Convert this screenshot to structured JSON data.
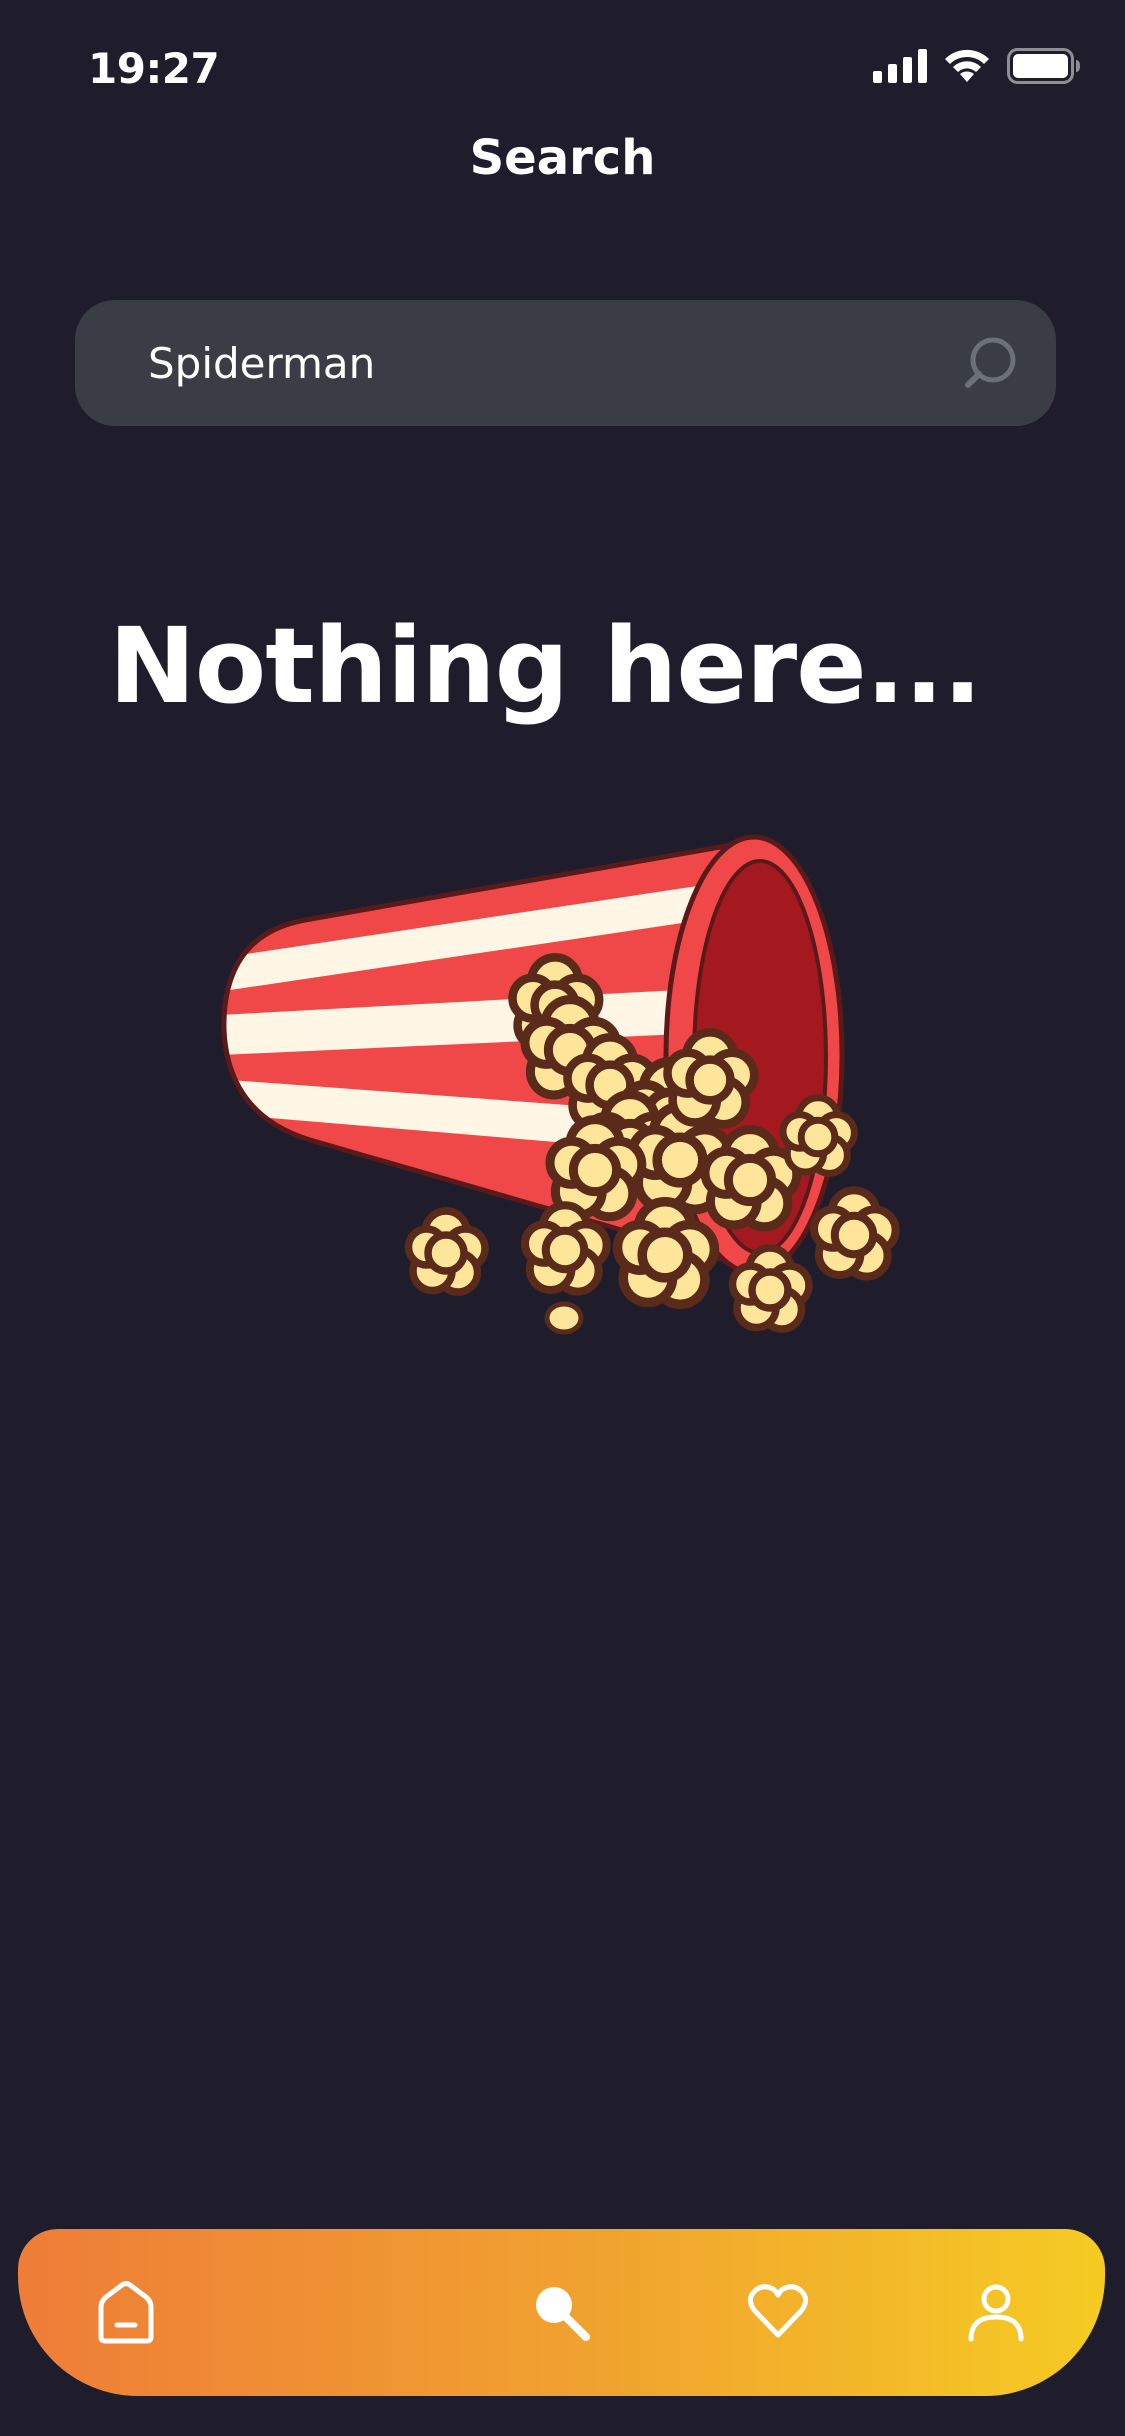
{
  "status_bar": {
    "time": "19:27",
    "icons": [
      "signal-icon",
      "wifi-icon",
      "battery-icon"
    ]
  },
  "header": {
    "title": "Search"
  },
  "search": {
    "value": "Spiderman",
    "icon": "search-icon"
  },
  "empty_state": {
    "title": "Nothing here...",
    "illustration": "spilled-popcorn-bucket"
  },
  "bottom_nav": {
    "items": [
      {
        "icon": "home-icon",
        "active": false
      },
      {
        "icon": "search-icon",
        "active": true
      },
      {
        "icon": "heart-icon",
        "active": false
      },
      {
        "icon": "profile-icon",
        "active": false
      }
    ]
  },
  "colors": {
    "background": "#1f1d2b",
    "search_field": "#3a3d45",
    "nav_gradient_start": "#ee7d38",
    "nav_gradient_end": "#f5cb23",
    "popcorn_stripe_red": "#f04848",
    "popcorn_stripe_cream": "#fff6e6",
    "popcorn_kernel": "#ffe599"
  }
}
